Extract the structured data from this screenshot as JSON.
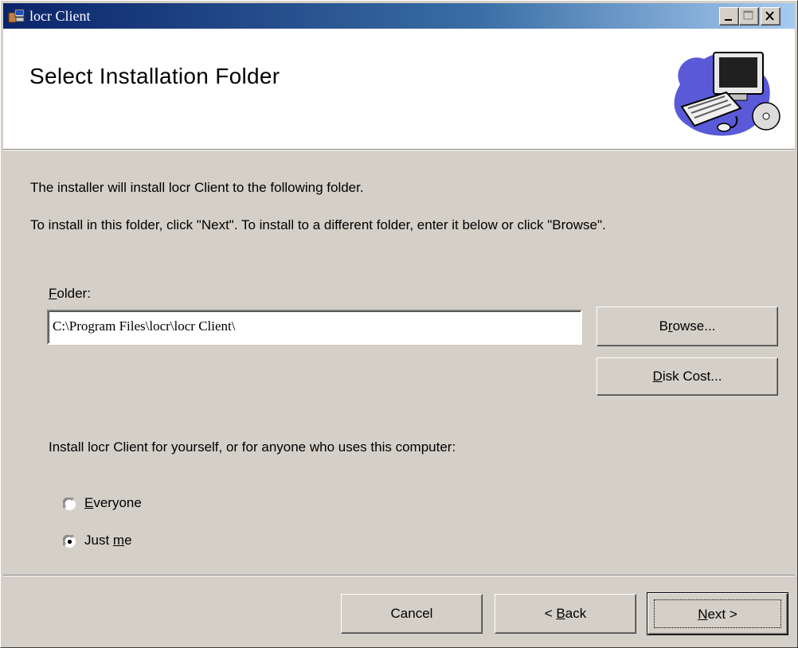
{
  "window": {
    "title": "locr Client"
  },
  "banner": {
    "heading": "Select Installation Folder"
  },
  "body": {
    "intro_line1": "The installer will install locr Client to the following folder.",
    "intro_line2": "To install in this folder, click \"Next\". To install to a different folder, enter it below or click \"Browse\".",
    "folder_label_mnemonic": "F",
    "folder_label_rest": "older:",
    "folder_value": "C:\\Program Files\\locr\\locr Client\\",
    "install_for_text": "Install locr Client for yourself, or for anyone who uses this computer:"
  },
  "buttons": {
    "browse_pre": "B",
    "browse_mnemonic": "r",
    "browse_post": "owse...",
    "diskcost_mnemonic": "D",
    "diskcost_post": "isk Cost...",
    "cancel": "Cancel",
    "back_pre": "< ",
    "back_mnemonic": "B",
    "back_post": "ack",
    "next_mnemonic": "N",
    "next_post": "ext >"
  },
  "radios": {
    "everyone_mnemonic": "E",
    "everyone_post": "veryone",
    "justme_pre": "Just ",
    "justme_mnemonic": "m",
    "justme_post": "e",
    "selected": "Just me"
  },
  "colors": {
    "title_gradient_start": "#0a246a",
    "title_gradient_end": "#a6caf0",
    "dialog_face": "#d4d0c8"
  },
  "icons": [
    "installer-app-icon",
    "minimize-icon",
    "maximize-icon",
    "close-icon",
    "computer-cd-illustration",
    "radio-unselected",
    "radio-selected"
  ]
}
